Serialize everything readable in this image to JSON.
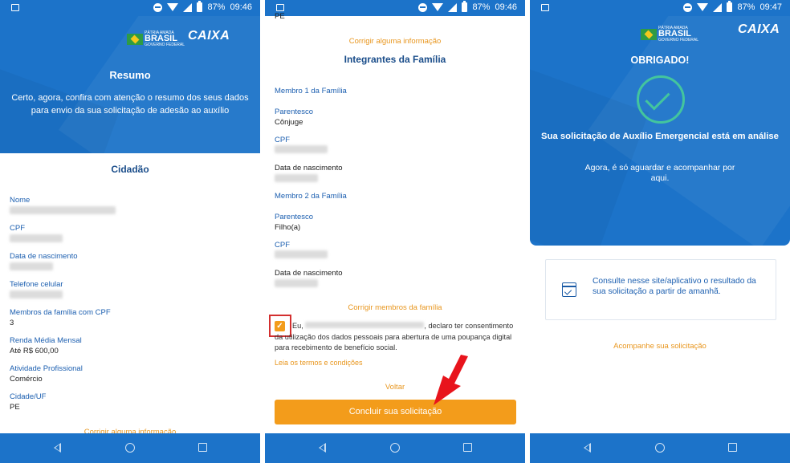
{
  "status": {
    "left": {
      "battery": "87%",
      "time": "09:46"
    },
    "middle": {
      "battery": "87%",
      "time": "09:46"
    },
    "right": {
      "battery": "87%",
      "time": "09:47"
    }
  },
  "logos": {
    "brasil_small": "PÁTRIA AMADA",
    "brasil": "BRASIL",
    "brasil_sub": "GOVERNO FEDERAL",
    "caixa": "CAIXA"
  },
  "screen1": {
    "title": "Resumo",
    "intro": "Certo, agora, confira com atenção o resumo dos seus dados para envio da sua solicitação de adesão ao auxílio",
    "section": "Cidadão",
    "fields": [
      {
        "label": "Nome",
        "value": ""
      },
      {
        "label": "CPF",
        "value": ""
      },
      {
        "label": "Data de nascimento",
        "value": ""
      },
      {
        "label": "Telefone celular",
        "value": ""
      },
      {
        "label": "Membros da família com CPF",
        "value": "3"
      },
      {
        "label": "Renda Média Mensal",
        "value": "Até R$ 600,00"
      },
      {
        "label": "Atividade Profissional",
        "value": "Comércio"
      },
      {
        "label": "Cidade/UF",
        "value": "PE"
      }
    ],
    "correct_link": "Corrigir alguma informação"
  },
  "screen2": {
    "top_value": "PE",
    "correct_link": "Corrigir alguma informação",
    "section": "Integrantes da Família",
    "member1": {
      "title": "Membro 1 da Família",
      "parentesco_label": "Parentesco",
      "parentesco": "Cônjuge",
      "cpf_label": "CPF",
      "nasc_label": "Data de nascimento"
    },
    "member2": {
      "title": "Membro 2 da Família",
      "parentesco_label": "Parentesco",
      "parentesco": "Filho(a)",
      "cpf_label": "CPF",
      "nasc_label": "Data de nascimento"
    },
    "correct_members": "Corrigir membros da família",
    "consent_pre": "Eu,",
    "consent_post": ", declaro ter consentimento da utilização dos dados pessoais para abertura de uma poupança digital para recebimento de benefício social.",
    "terms": "Leia os termos e condições",
    "voltar": "Voltar",
    "submit": "Concluir sua solicitação"
  },
  "screen3": {
    "thanks": "OBRIGADO!",
    "analysis": "Sua solicitação de Auxílio Emergencial está em análise",
    "wait": "Agora, é só aguardar e acompanhar por aqui.",
    "info": "Consulte nesse site/aplicativo o resultado da sua solicitação a partir de amanhã.",
    "follow": "Acompanhe sua solicitação"
  },
  "colors": {
    "primary": "#1c73c9",
    "accent": "#f39c1b",
    "success": "#43c59e",
    "highlight": "#d32f2f"
  }
}
